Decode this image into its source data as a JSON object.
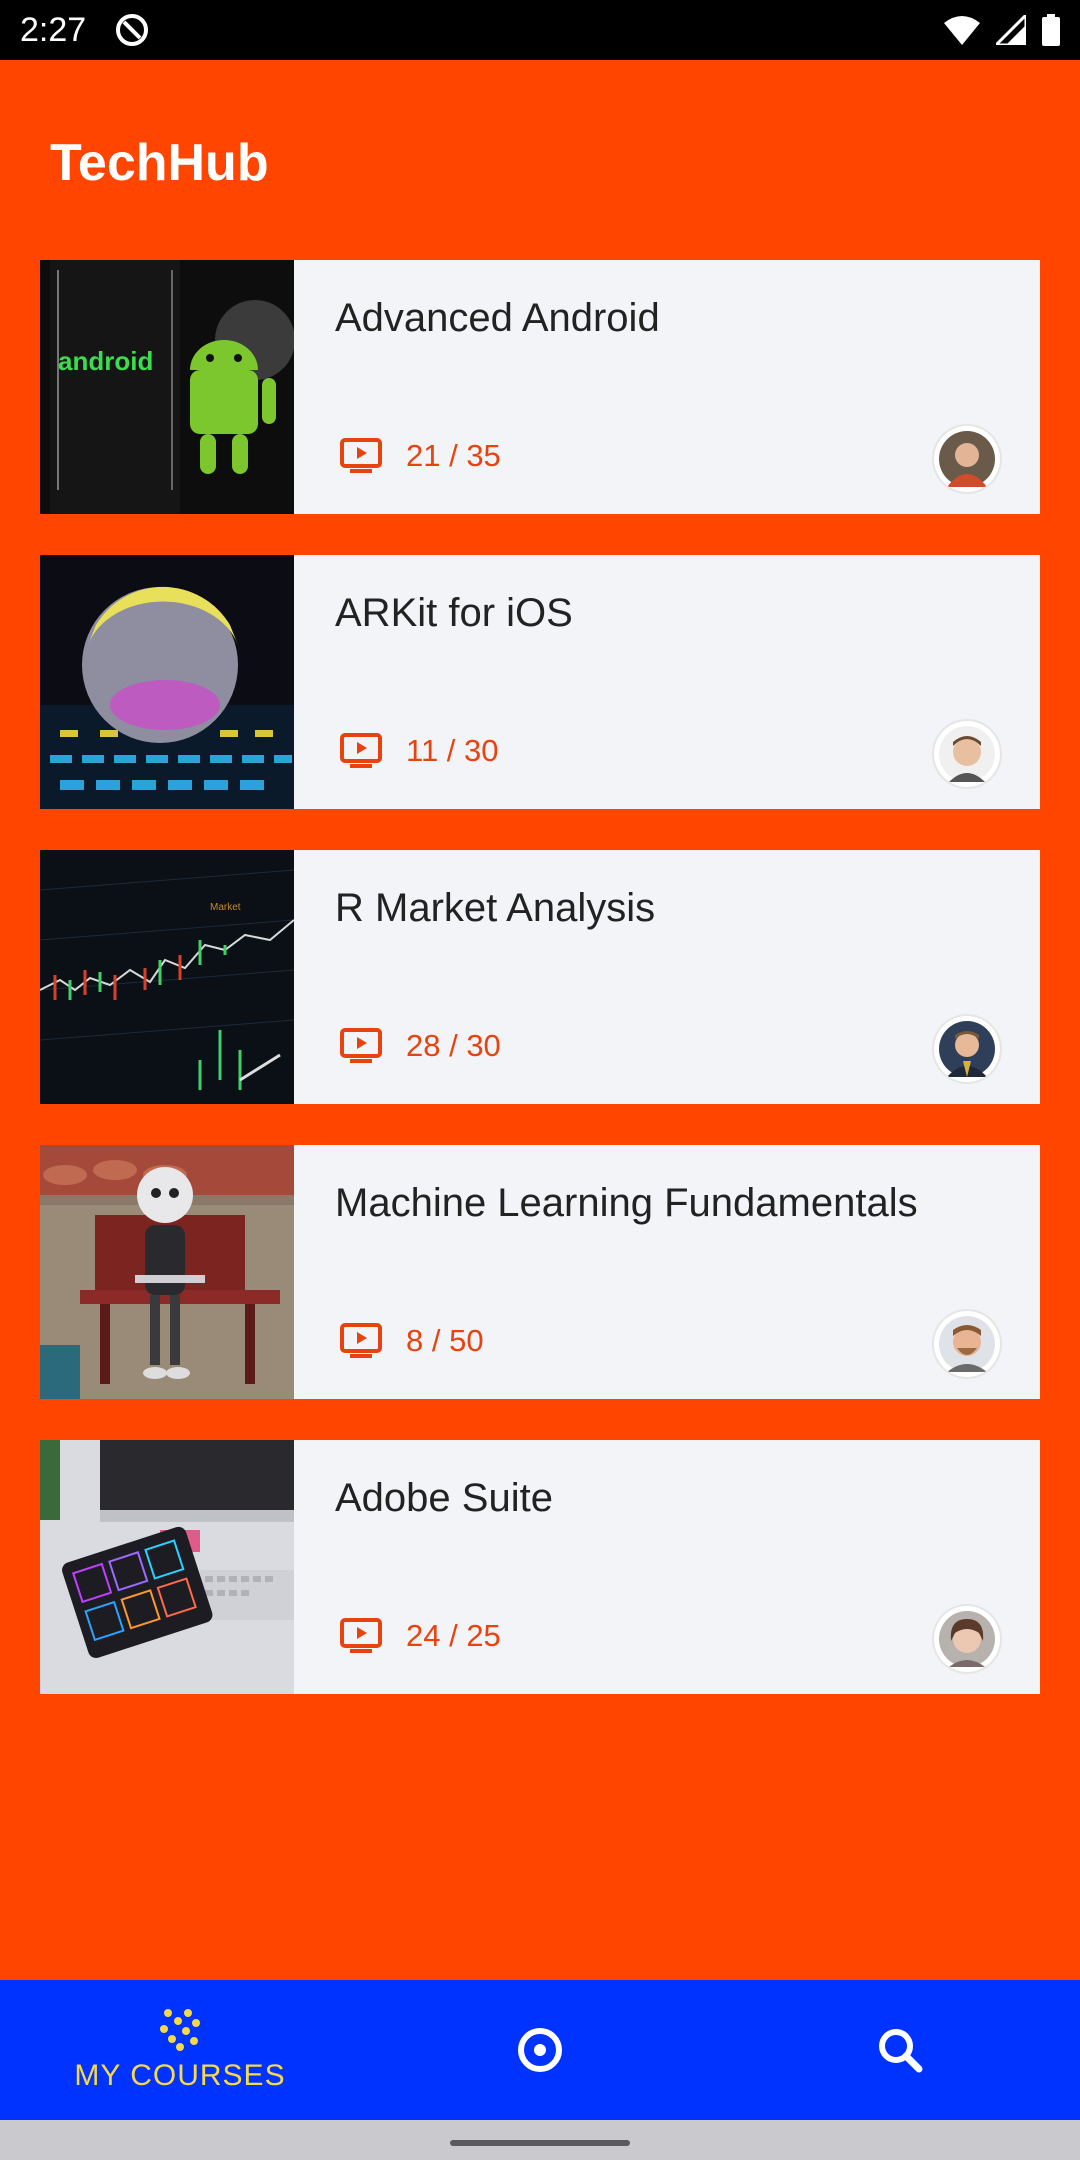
{
  "status_bar": {
    "time": "2:27"
  },
  "app": {
    "title": "TechHub"
  },
  "courses": [
    {
      "title": "Advanced Android",
      "progress": "21 / 35"
    },
    {
      "title": "ARKit for iOS",
      "progress": "11 / 30"
    },
    {
      "title": "R Market Analysis",
      "progress": "28 / 30"
    },
    {
      "title": "Machine Learning Fundamentals",
      "progress": "8 / 50"
    },
    {
      "title": "Adobe Suite",
      "progress": "24 / 25"
    }
  ],
  "bottom_nav": {
    "items": [
      {
        "label": "MY COURSES",
        "icon": "courses-dots-icon"
      },
      {
        "label": "",
        "icon": "explore-target-icon"
      },
      {
        "label": "",
        "icon": "search-icon"
      }
    ]
  },
  "colors": {
    "background": "#FF4500",
    "nav_bar": "#0033FF",
    "nav_active": "#F6D94A",
    "card": "#F3F4F8",
    "accent_text": "#E8430F"
  }
}
